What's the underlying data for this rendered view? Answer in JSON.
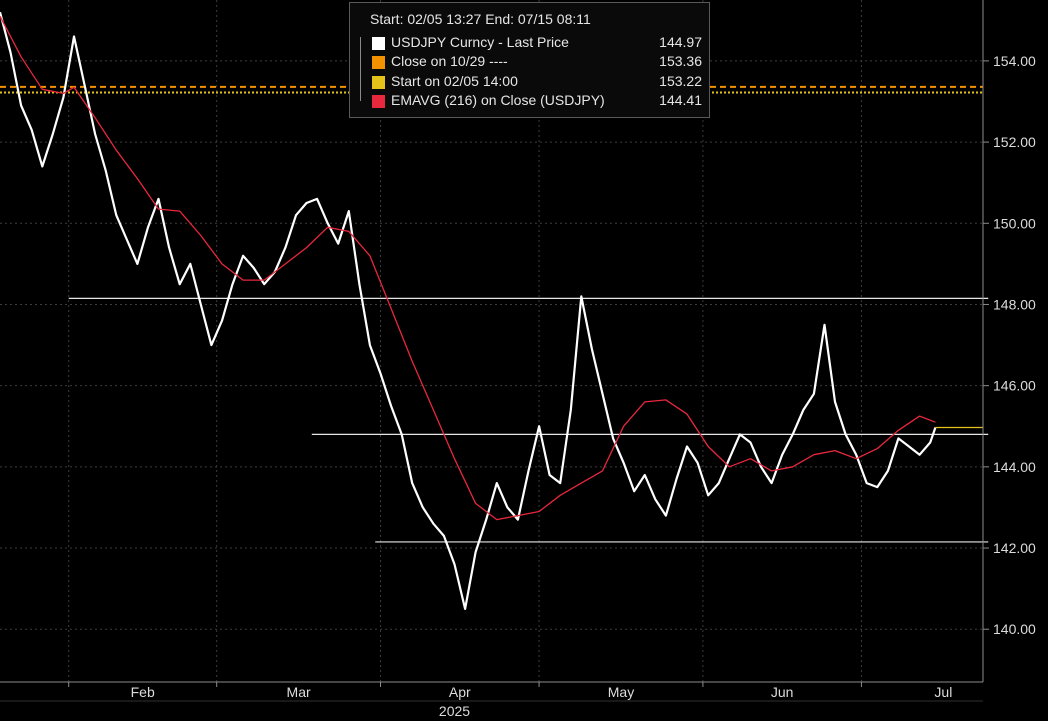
{
  "legend": {
    "header": "Start: 02/05 13:27 End: 07/15 08:11",
    "rows": [
      {
        "label": "USDJPY Curncy - Last Price",
        "value": "144.97",
        "color": "#ffffff"
      },
      {
        "label": "Close on 10/29 ----",
        "value": "153.36",
        "color": "#f39200"
      },
      {
        "label": "Start on 02/05 14:00",
        "value": "153.22",
        "color": "#e5c21a"
      },
      {
        "label": "EMAVG (216)  on Close (USDJPY)",
        "value": "144.41",
        "color": "#e8283c"
      }
    ]
  },
  "chart_data": {
    "type": "line",
    "title": "",
    "xlabel": "2025",
    "ylabel": "",
    "ylim": [
      138.7,
      155.5
    ],
    "y_ticks": [
      "140.00",
      "142.00",
      "144.00",
      "146.00",
      "148.00",
      "150.00",
      "152.00",
      "154.00"
    ],
    "y_tick_values": [
      140,
      142,
      144,
      146,
      148,
      150,
      152,
      154
    ],
    "x_range": [
      "2025-01-19",
      "2025-07-24"
    ],
    "month_ticks": [
      {
        "label": "Feb",
        "date": "2025-02-01"
      },
      {
        "label": "Mar",
        "date": "2025-03-01"
      },
      {
        "label": "Apr",
        "date": "2025-04-01"
      },
      {
        "label": "May",
        "date": "2025-05-01"
      },
      {
        "label": "Jun",
        "date": "2025-06-01"
      },
      {
        "label": "Jul",
        "date": "2025-07-01"
      }
    ],
    "grid": true,
    "legend_position": "top-center",
    "colors": {
      "background": "#000000",
      "grid": "#3c3c3c",
      "text": "#dcdcdc",
      "axis": "#8c8c8c",
      "price": "#ffffff",
      "ema": "#e8283c",
      "close_ref": "#f39200",
      "start_ref": "#e5c21a"
    },
    "series": [
      {
        "name": "USDJPY Curncy - Last Price",
        "x": [
          "2025-01-19",
          "2025-01-21",
          "2025-01-23",
          "2025-01-25",
          "2025-01-27",
          "2025-01-29",
          "2025-01-31",
          "2025-02-02",
          "2025-02-04",
          "2025-02-06",
          "2025-02-08",
          "2025-02-10",
          "2025-02-12",
          "2025-02-14",
          "2025-02-16",
          "2025-02-18",
          "2025-02-20",
          "2025-02-22",
          "2025-02-24",
          "2025-02-26",
          "2025-02-28",
          "2025-03-02",
          "2025-03-04",
          "2025-03-06",
          "2025-03-08",
          "2025-03-10",
          "2025-03-12",
          "2025-03-14",
          "2025-03-16",
          "2025-03-18",
          "2025-03-20",
          "2025-03-22",
          "2025-03-24",
          "2025-03-26",
          "2025-03-28",
          "2025-03-30",
          "2025-04-01",
          "2025-04-03",
          "2025-04-05",
          "2025-04-07",
          "2025-04-09",
          "2025-04-11",
          "2025-04-13",
          "2025-04-15",
          "2025-04-17",
          "2025-04-19",
          "2025-04-21",
          "2025-04-23",
          "2025-04-25",
          "2025-04-27",
          "2025-04-29",
          "2025-05-01",
          "2025-05-03",
          "2025-05-05",
          "2025-05-07",
          "2025-05-09",
          "2025-05-11",
          "2025-05-13",
          "2025-05-15",
          "2025-05-17",
          "2025-05-19",
          "2025-05-21",
          "2025-05-23",
          "2025-05-25",
          "2025-05-27",
          "2025-05-29",
          "2025-05-31",
          "2025-06-02",
          "2025-06-04",
          "2025-06-06",
          "2025-06-08",
          "2025-06-10",
          "2025-06-12",
          "2025-06-14",
          "2025-06-16",
          "2025-06-18",
          "2025-06-20",
          "2025-06-22",
          "2025-06-24",
          "2025-06-26",
          "2025-06-28",
          "2025-06-30",
          "2025-07-02",
          "2025-07-04",
          "2025-07-06",
          "2025-07-08",
          "2025-07-10",
          "2025-07-12",
          "2025-07-14",
          "2025-07-15"
        ],
        "values": [
          155.2,
          154.2,
          152.9,
          152.3,
          151.4,
          152.2,
          153.1,
          154.6,
          153.4,
          152.2,
          151.3,
          150.2,
          149.6,
          149.0,
          149.9,
          150.6,
          149.4,
          148.5,
          149.0,
          148.0,
          147.0,
          147.6,
          148.5,
          149.2,
          148.9,
          148.5,
          148.8,
          149.4,
          150.2,
          150.5,
          150.6,
          150.0,
          149.5,
          150.3,
          148.5,
          147.0,
          146.3,
          145.5,
          144.8,
          143.6,
          143.0,
          142.6,
          142.3,
          141.6,
          140.5,
          141.9,
          142.7,
          143.6,
          143.0,
          142.7,
          143.9,
          145.0,
          143.8,
          143.6,
          145.4,
          148.2,
          146.9,
          145.8,
          144.7,
          144.1,
          143.4,
          143.8,
          143.2,
          142.8,
          143.7,
          144.5,
          144.1,
          143.3,
          143.6,
          144.2,
          144.8,
          144.6,
          144.0,
          143.6,
          144.3,
          144.8,
          145.4,
          145.8,
          147.5,
          145.6,
          144.8,
          144.3,
          143.6,
          143.5,
          143.9,
          144.7,
          144.5,
          144.3,
          144.6,
          144.97
        ]
      },
      {
        "name": "EMAVG (216)  on Close (USDJPY)",
        "x": [
          "2025-01-19",
          "2025-01-23",
          "2025-01-27",
          "2025-01-31",
          "2025-02-02",
          "2025-02-06",
          "2025-02-10",
          "2025-02-14",
          "2025-02-18",
          "2025-02-22",
          "2025-02-26",
          "2025-03-02",
          "2025-03-06",
          "2025-03-10",
          "2025-03-14",
          "2025-03-18",
          "2025-03-22",
          "2025-03-26",
          "2025-03-30",
          "2025-04-03",
          "2025-04-07",
          "2025-04-11",
          "2025-04-15",
          "2025-04-19",
          "2025-04-23",
          "2025-04-27",
          "2025-05-01",
          "2025-05-05",
          "2025-05-09",
          "2025-05-13",
          "2025-05-17",
          "2025-05-21",
          "2025-05-25",
          "2025-05-29",
          "2025-06-02",
          "2025-06-06",
          "2025-06-10",
          "2025-06-14",
          "2025-06-18",
          "2025-06-22",
          "2025-06-26",
          "2025-06-30",
          "2025-07-04",
          "2025-07-08",
          "2025-07-12",
          "2025-07-15"
        ],
        "values": [
          155.1,
          154.1,
          153.3,
          153.2,
          153.35,
          152.6,
          151.8,
          151.1,
          150.35,
          150.3,
          149.7,
          149.0,
          148.6,
          148.6,
          149.0,
          149.4,
          149.9,
          149.8,
          149.2,
          147.9,
          146.6,
          145.4,
          144.2,
          143.1,
          142.7,
          142.8,
          142.9,
          143.3,
          143.6,
          143.9,
          145.0,
          145.6,
          145.65,
          145.3,
          144.5,
          144.0,
          144.2,
          143.9,
          144.0,
          144.3,
          144.4,
          144.2,
          144.45,
          144.9,
          145.25,
          145.1
        ]
      }
    ],
    "reference_lines": [
      {
        "name": "Close on 10/29",
        "value": 153.36,
        "style": "dashed"
      },
      {
        "name": "Start on 02/05 14:00",
        "value": 153.22,
        "style": "dotted"
      }
    ],
    "annotations": [
      {
        "type": "hline",
        "value": 148.15,
        "from": "2025-02-01",
        "to": "2025-07-25"
      },
      {
        "type": "hline",
        "value": 144.8,
        "from": "2025-03-19",
        "to": "2025-07-25"
      },
      {
        "type": "hline",
        "value": 142.15,
        "from": "2025-03-31",
        "to": "2025-07-25"
      }
    ]
  }
}
